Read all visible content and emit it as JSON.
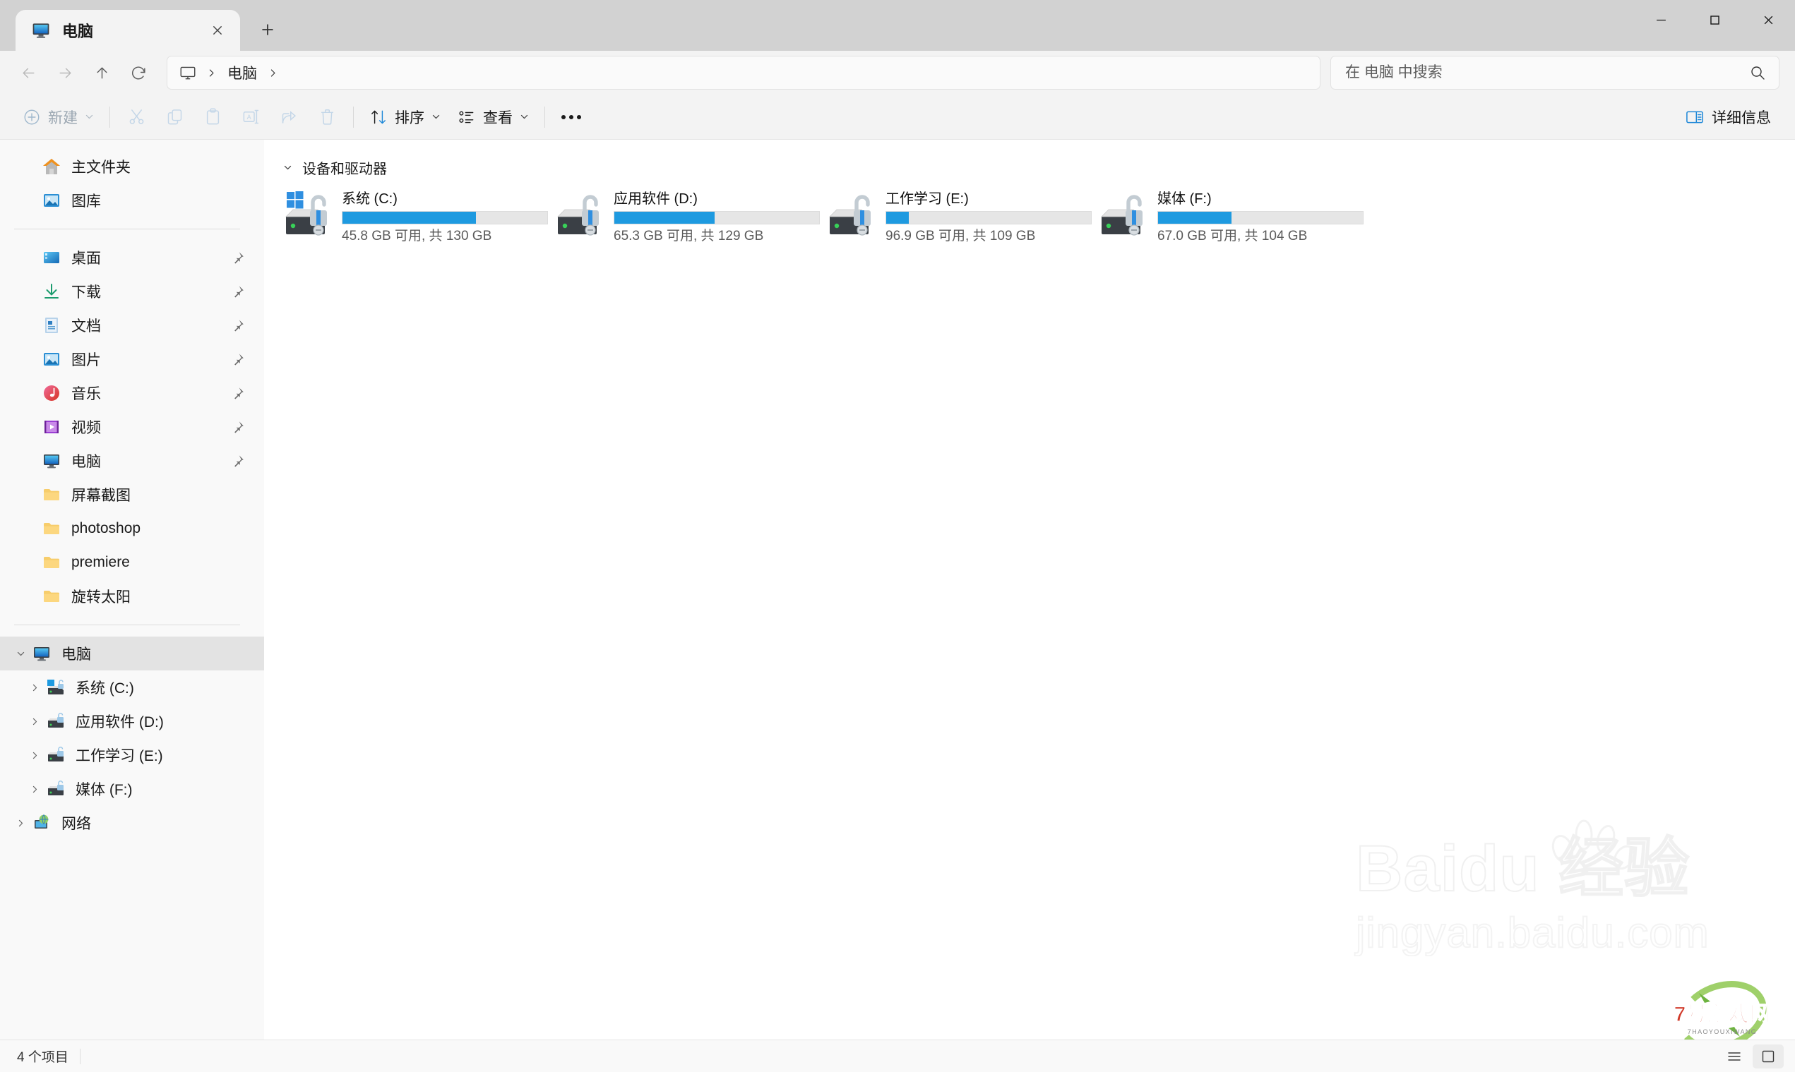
{
  "window": {
    "title": "电脑",
    "controls": {
      "minimize": "minimize-icon",
      "maximize": "maximize-icon",
      "close": "close-icon"
    }
  },
  "tabs": [
    {
      "label": "电脑",
      "icon": "computer-icon",
      "active": true
    }
  ],
  "newtab_label": "新建标签页",
  "nav": {
    "back": "后退",
    "forward": "前进",
    "up": "向上",
    "refresh": "刷新"
  },
  "breadcrumb": {
    "root_icon": "monitor-icon",
    "items": [
      "电脑"
    ]
  },
  "search": {
    "placeholder": "在 电脑 中搜索",
    "value": "",
    "icon": "search-icon"
  },
  "toolbar": {
    "new_label": "新建",
    "cut_label": "剪切",
    "copy_label": "复制",
    "paste_label": "粘贴",
    "rename_label": "重命名",
    "share_label": "共享",
    "delete_label": "删除",
    "sort_label": "排序",
    "view_label": "查看",
    "more_label": "查看更多",
    "details_label": "详细信息"
  },
  "sidebar": {
    "quick": [
      {
        "label": "主文件夹",
        "icon": "home-icon",
        "pinned": false
      },
      {
        "label": "图库",
        "icon": "gallery-icon",
        "pinned": false
      }
    ],
    "pinned": [
      {
        "label": "桌面",
        "icon": "desktop-icon",
        "pinned": true
      },
      {
        "label": "下载",
        "icon": "downloads-icon",
        "pinned": true
      },
      {
        "label": "文档",
        "icon": "documents-icon",
        "pinned": true
      },
      {
        "label": "图片",
        "icon": "pictures-icon",
        "pinned": true
      },
      {
        "label": "音乐",
        "icon": "music-icon",
        "pinned": true
      },
      {
        "label": "视频",
        "icon": "videos-icon",
        "pinned": true
      },
      {
        "label": "电脑",
        "icon": "computer-icon",
        "pinned": true
      },
      {
        "label": "屏幕截图",
        "icon": "folder-icon",
        "pinned": false
      },
      {
        "label": "photoshop",
        "icon": "folder-icon",
        "pinned": false
      },
      {
        "label": "premiere",
        "icon": "folder-icon",
        "pinned": false
      },
      {
        "label": "旋转太阳",
        "icon": "folder-icon",
        "pinned": false
      }
    ],
    "tree": [
      {
        "label": "电脑",
        "icon": "computer-icon",
        "level": 1,
        "expanded": true,
        "selected": true
      },
      {
        "label": "系统 (C:)",
        "icon": "drive-windows-icon",
        "level": 2,
        "expanded": false,
        "selected": false
      },
      {
        "label": "应用软件 (D:)",
        "icon": "drive-icon",
        "level": 2,
        "expanded": false,
        "selected": false
      },
      {
        "label": "工作学习 (E:)",
        "icon": "drive-icon",
        "level": 2,
        "expanded": false,
        "selected": false
      },
      {
        "label": "媒体 (F:)",
        "icon": "drive-icon",
        "level": 2,
        "expanded": false,
        "selected": false
      },
      {
        "label": "网络",
        "icon": "network-icon",
        "level": 1,
        "expanded": false,
        "selected": false
      }
    ]
  },
  "content": {
    "group_title": "设备和驱动器",
    "group_expanded": true,
    "drives": [
      {
        "name": "系统 (C:)",
        "free_text": "45.8 GB 可用, 共 130 GB",
        "free_gb": 45.8,
        "total_gb": 130,
        "used_percent": 65,
        "icon": "drive-windows-bitlocker-icon",
        "bar_color": "#1e9ae0"
      },
      {
        "name": "应用软件 (D:)",
        "free_text": "65.3 GB 可用, 共 129 GB",
        "free_gb": 65.3,
        "total_gb": 129,
        "used_percent": 49,
        "icon": "drive-bitlocker-icon",
        "bar_color": "#1e9ae0"
      },
      {
        "name": "工作学习 (E:)",
        "free_text": "96.9 GB 可用, 共 109 GB",
        "free_gb": 96.9,
        "total_gb": 109,
        "used_percent": 11,
        "icon": "drive-bitlocker-icon",
        "bar_color": "#1e9ae0"
      },
      {
        "name": "媒体 (F:)",
        "free_text": "67.0 GB 可用, 共 104 GB",
        "free_gb": 67.0,
        "total_gb": 104,
        "used_percent": 36,
        "icon": "drive-bitlocker-icon",
        "bar_color": "#1e9ae0"
      }
    ]
  },
  "watermark": {
    "brand": "Baidu 经验",
    "brand_left": "Bai",
    "brand_right": "du",
    "brand_cn": "经验",
    "url": "jingyan.baidu.com",
    "game_site": "7号游戏网",
    "game_site_pinyin": "7HAOYOUXIWANG"
  },
  "statusbar": {
    "item_count_text": "4 个项目",
    "list_view_label": "列表视图",
    "detail_view_label": "大图标视图"
  },
  "colors": {
    "accent": "#1e9ae0",
    "selection": "#e3e3e3",
    "chrome": "#f3f3f3",
    "titlebar": "#d2d2d2"
  }
}
